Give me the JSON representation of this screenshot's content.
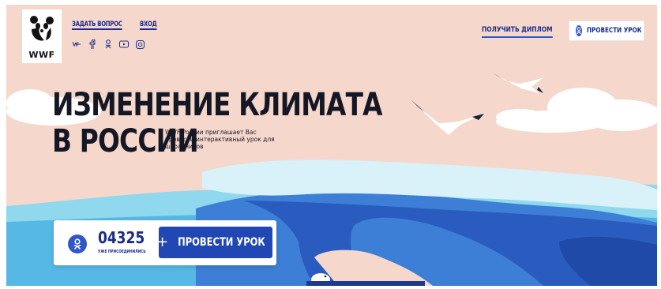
{
  "logo": {
    "text": "WWF"
  },
  "nav": {
    "ask_label": "ЗАДАТЬ ВОПРОС",
    "login_label": "ВХОД"
  },
  "socials": [
    {
      "icon": "vk-icon",
      "glyph": "vk"
    },
    {
      "icon": "facebook-icon",
      "glyph": "f"
    },
    {
      "icon": "odnoklassniki-icon",
      "glyph": "ok"
    },
    {
      "icon": "youtube-icon",
      "glyph": "yt"
    },
    {
      "icon": "instagram-icon",
      "glyph": "ig"
    }
  ],
  "header": {
    "diploma_label": "ПОЛУЧИТЬ ДИПЛОМ",
    "lesson_label": "ПРОВЕСТИ УРОК"
  },
  "hero": {
    "title_line1": "ИЗМЕНЕНИЕ КЛИМАТА",
    "title_line2": "В РОССИИ",
    "subtitle": "WWF России приглашает Вас провести интерактивный урок для школьников"
  },
  "counter": {
    "value": "04325",
    "label": "УЖЕ ПРИСОЕДИНИЛИСЬ",
    "button_label": "ПРОВЕСТИ УРОК",
    "button_icon": "plus"
  },
  "colors": {
    "sky": "#f5d7cc",
    "accent": "#2147b5",
    "brand_text": "#1a2b8a",
    "ice_light": "#d9f1f8",
    "water": "#3d7fd6"
  }
}
